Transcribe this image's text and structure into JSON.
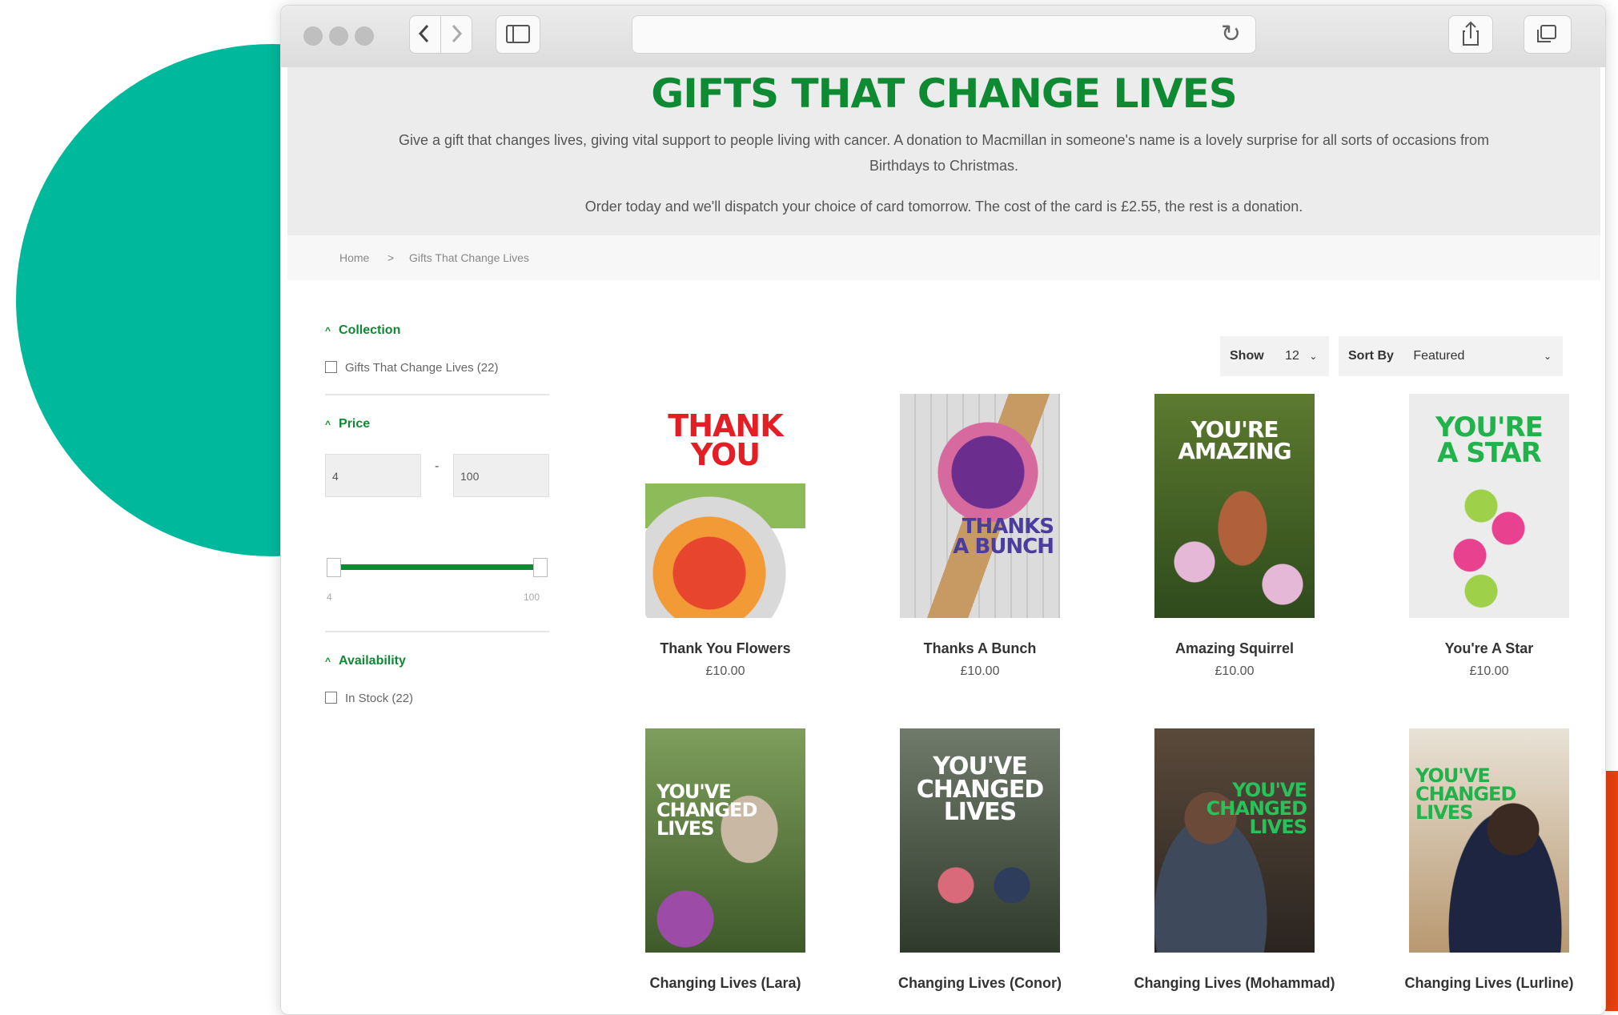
{
  "browser": {
    "back_icon": "chevron-left-icon",
    "forward_icon": "chevron-right-icon",
    "sidebar_icon": "sidebar-icon",
    "reload_icon": "reload-icon",
    "share_icon": "share-icon",
    "tabs_icon": "tabs-icon"
  },
  "hero": {
    "title": "GIFTS THAT CHANGE LIVES",
    "description_line1": "Give a gift that changes lives, giving vital support to people living with cancer. A donation to Macmillan in someone's name is a lovely surprise for all sorts of occasions from",
    "description_line2": "Birthdays to Christmas.",
    "order_note": "Order today and we'll dispatch your choice of card tomorrow. The cost of the card is £2.55, the rest is a donation."
  },
  "breadcrumb": {
    "home": "Home",
    "separator": ">",
    "current": "Gifts That Change Lives"
  },
  "filters": {
    "collection": {
      "label": "Collection",
      "option": "Gifts That Change Lives (22)"
    },
    "price": {
      "label": "Price",
      "min": "4",
      "separator": "-",
      "max": "100",
      "range_min_label": "4",
      "range_max_label": "100"
    },
    "availability": {
      "label": "Availability",
      "option": "In Stock (22)"
    }
  },
  "controls": {
    "show_label": "Show",
    "show_value": "12",
    "sort_label": "Sort By",
    "sort_value": "Featured"
  },
  "products": [
    {
      "name": "Thank You Flowers",
      "price": "£10.00",
      "card_text": [
        "THANK",
        "YOU"
      ]
    },
    {
      "name": "Thanks A Bunch",
      "price": "£10.00",
      "card_text": [
        "THANKS",
        "A BUNCH"
      ]
    },
    {
      "name": "Amazing Squirrel",
      "price": "£10.00",
      "card_text": [
        "YOU'RE",
        "AMAZING"
      ]
    },
    {
      "name": "You're A Star",
      "price": "£10.00",
      "card_text": [
        "YOU'RE",
        "A STAR"
      ]
    },
    {
      "name": "Changing Lives (Lara)",
      "price": "",
      "card_text": [
        "YOU'VE",
        "CHANGED",
        "LIVES"
      ]
    },
    {
      "name": "Changing Lives (Conor)",
      "price": "",
      "card_text": [
        "YOU'VE",
        "CHANGED",
        "LIVES"
      ]
    },
    {
      "name": "Changing Lives (Mohammad)",
      "price": "",
      "card_text": [
        "YOU'VE",
        "CHANGED",
        "LIVES"
      ]
    },
    {
      "name": "Changing Lives (Lurline)",
      "price": "",
      "card_text": [
        "YOU'VE",
        "CHANGED",
        "LIVES"
      ]
    }
  ],
  "colors": {
    "brand_green": "#0e8a32",
    "teal": "#00b89c",
    "orange": "#e8410e"
  }
}
